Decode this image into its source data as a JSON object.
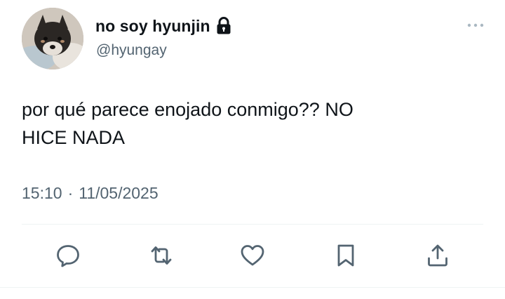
{
  "user": {
    "display_name": "no soy hyunjin",
    "handle": "@hyungay",
    "protected": true
  },
  "tweet": {
    "text": "por qué parece enojado conmigo?? NO\nHICE NADA",
    "time": "15:10",
    "separator": "·",
    "date": "11/05/2025"
  },
  "icons": {
    "more": "more-horizontal-icon",
    "lock": "lock-icon",
    "reply": "reply-icon",
    "retweet": "retweet-icon",
    "like": "heart-icon",
    "bookmark": "bookmark-icon",
    "share": "share-icon"
  },
  "colors": {
    "icon": "#536471",
    "text": "#0f1419",
    "secondary": "#536471",
    "divider": "#eff3f4"
  }
}
